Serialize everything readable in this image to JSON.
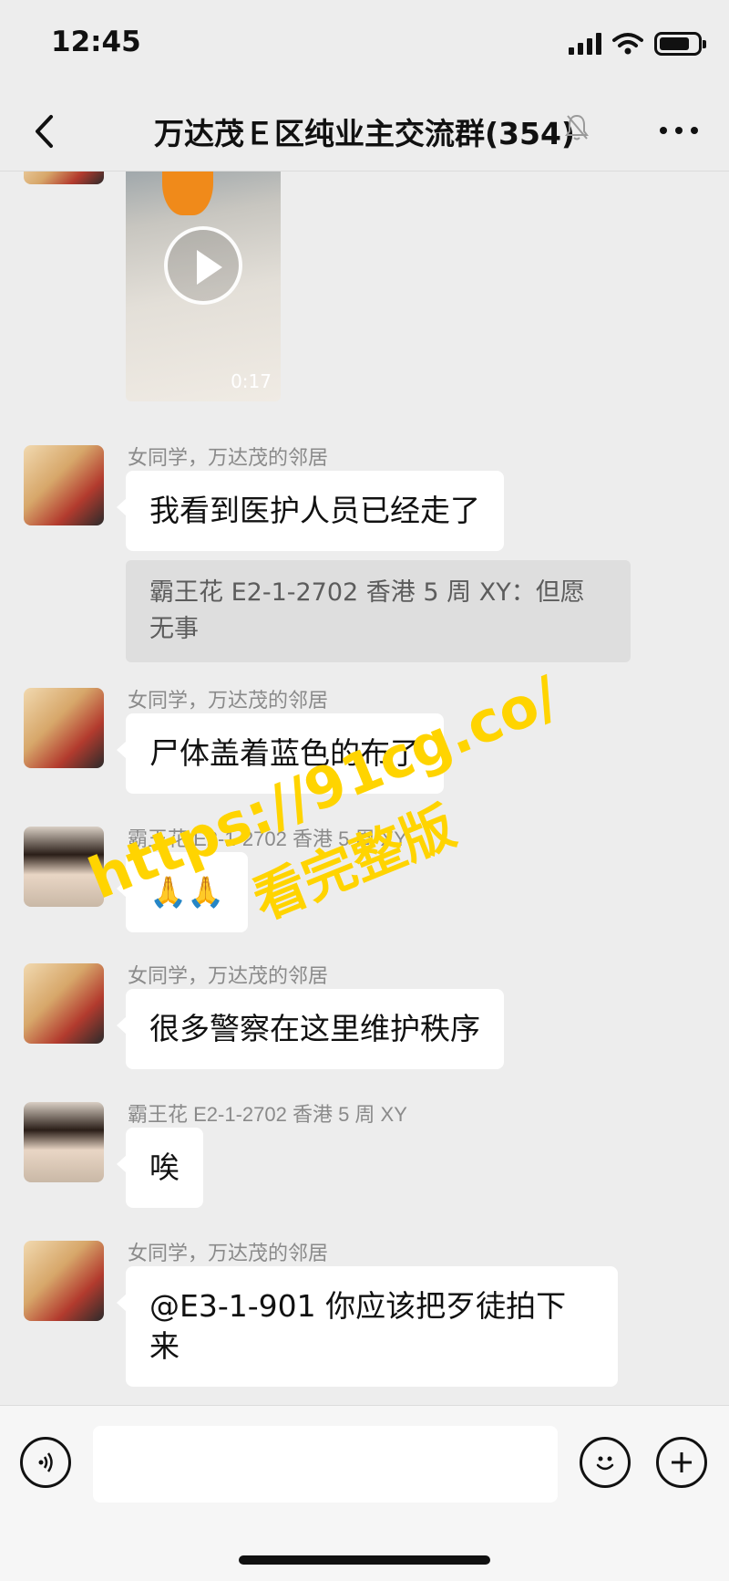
{
  "status": {
    "time": "12:45",
    "battery_level": 0.8
  },
  "header": {
    "title": "万达茂Ｅ区纯业主交流群(354)"
  },
  "video": {
    "duration": "0:17"
  },
  "messages": [
    {
      "sender": "女同学，万达茂的邻居",
      "text": "我看到医护人员已经走了",
      "quote": "霸王花 E2-1-2702 香港 5 周 XY：但愿无事"
    },
    {
      "sender": "女同学，万达茂的邻居",
      "text": "尸体盖着蓝色的布了"
    },
    {
      "sender": "霸王花 E2-1-2702 香港 5 周 XY",
      "text": "🙏🙏"
    },
    {
      "sender": "女同学，万达茂的邻居",
      "text": "很多警察在这里维护秩序"
    },
    {
      "sender": "霸王花 E2-1-2702 香港 5 周 XY",
      "text": "唉"
    },
    {
      "sender": "女同学，万达茂的邻居",
      "text": "@E3-1-901 你应该把歹徒拍下来"
    }
  ],
  "watermark": {
    "line1": "https://91cg.co/",
    "line2": "看完整版"
  },
  "input": {
    "placeholder": ""
  },
  "icons": {
    "voice": "voice-icon",
    "emoji": "emoji-icon",
    "plus": "plus-icon",
    "back": "back-icon",
    "mute": "mute-icon",
    "more": "more-icon"
  }
}
